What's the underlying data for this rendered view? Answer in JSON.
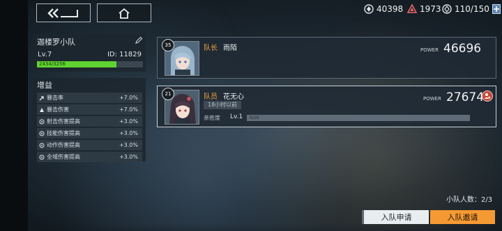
{
  "resources": [
    {
      "icon": "crystal-icon",
      "value": "40398"
    },
    {
      "icon": "gem-triangle-icon",
      "value": "1973"
    },
    {
      "icon": "stamina-icon",
      "value": "110/150"
    }
  ],
  "team": {
    "name": "迦楼罗小队",
    "level": "Lv.7",
    "id_text": "ID: 11829",
    "exp_text": "2434/3256",
    "exp_progress": 0.75
  },
  "buffs": {
    "title": "增益",
    "items": [
      {
        "icon": "crit-rate-icon",
        "label": "暴击率",
        "value": "+7.0%"
      },
      {
        "icon": "crit-damage-icon",
        "label": "暴击伤害",
        "value": "+7.0%"
      },
      {
        "icon": "shoot-damage-icon",
        "label": "射击伤害提高",
        "value": "+3.0%"
      },
      {
        "icon": "skill-damage-icon",
        "label": "技能伤害提高",
        "value": "+3.0%"
      },
      {
        "icon": "action-damage-icon",
        "label": "动作伤害提高",
        "value": "+3.0%"
      },
      {
        "icon": "all-damage-icon",
        "label": "全域伤害提高",
        "value": "+3.0%"
      }
    ]
  },
  "members": [
    {
      "level": "35",
      "role": "队长",
      "name": "雨陌",
      "power_label": "POWER",
      "power": "46696"
    },
    {
      "level": "21",
      "role": "队员",
      "name": "花无心",
      "power_label": "POWER",
      "power": "27674",
      "last_online": "18小时以前",
      "intimacy_label": "亲密度",
      "intimacy_level": "Lv.1",
      "intimacy_text": "0/10",
      "intimacy_progress": 0.0
    }
  ],
  "footer": {
    "count_text": "小队人数：2/3",
    "apply_label": "入队申请",
    "invite_label": "入队邀请"
  }
}
